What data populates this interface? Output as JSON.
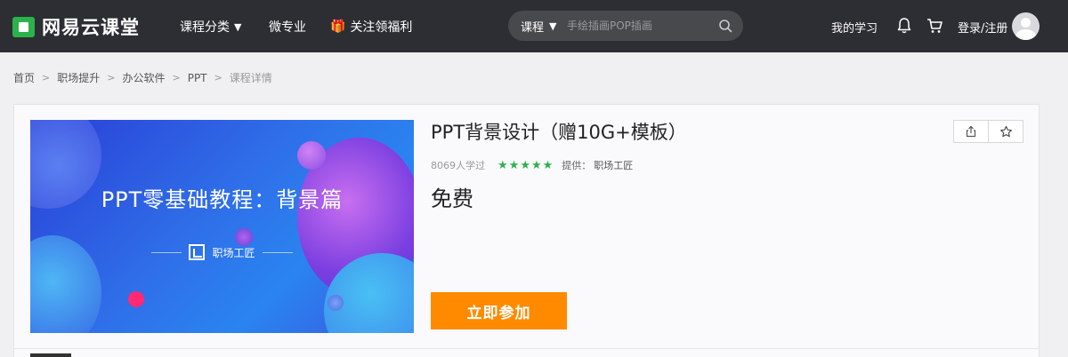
{
  "header": {
    "logo_text": "网易云课堂",
    "nav": {
      "category_label": "课程分类",
      "micro_major_label": "微专业",
      "gift_label": "关注领福利"
    },
    "search": {
      "type_label": "课程",
      "placeholder": "手绘插画POP插画"
    },
    "my_learning_label": "我的学习",
    "login_label": "登录/注册"
  },
  "breadcrumb": {
    "items": [
      "首页",
      "职场提升",
      "办公软件",
      "PPT"
    ],
    "current": "课程详情"
  },
  "course": {
    "banner_title": "PPT零基础教程：背景篇",
    "banner_brand": "职场工匠",
    "title": "PPT背景设计（赠10G+模板）",
    "learners": "8069人学过",
    "rating_stars": 5,
    "provider_label": "提供：",
    "provider_name": "职场工匠",
    "price": "免费",
    "join_label": "立即参加"
  },
  "colors": {
    "topbar": "#2c2e33",
    "accent_green": "#2bb24c",
    "join_orange": "#ff8a00"
  }
}
